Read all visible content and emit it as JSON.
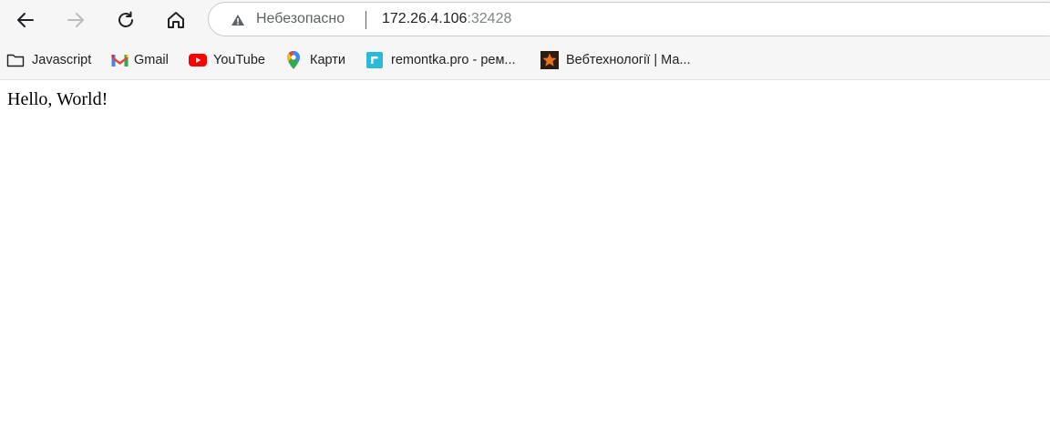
{
  "browser": {
    "security_label": "Небезопасно",
    "url_host": "172.26.4.106",
    "url_port": ":32428"
  },
  "bookmarks": [
    {
      "label": "Javascript",
      "icon": "folder-icon"
    },
    {
      "label": "Gmail",
      "icon": "gmail-icon"
    },
    {
      "label": "YouTube",
      "icon": "youtube-icon"
    },
    {
      "label": "Карти",
      "icon": "maps-icon"
    },
    {
      "label": "remontka.pro - рем...",
      "icon": "remontka-icon"
    },
    {
      "label": "Вебтехнології | Ма...",
      "icon": "webtech-icon"
    }
  ],
  "page": {
    "text": "Hello, World!"
  },
  "colors": {
    "toolbar_bg": "#f6f6f6",
    "text": "#202124",
    "muted": "#5f6368"
  }
}
